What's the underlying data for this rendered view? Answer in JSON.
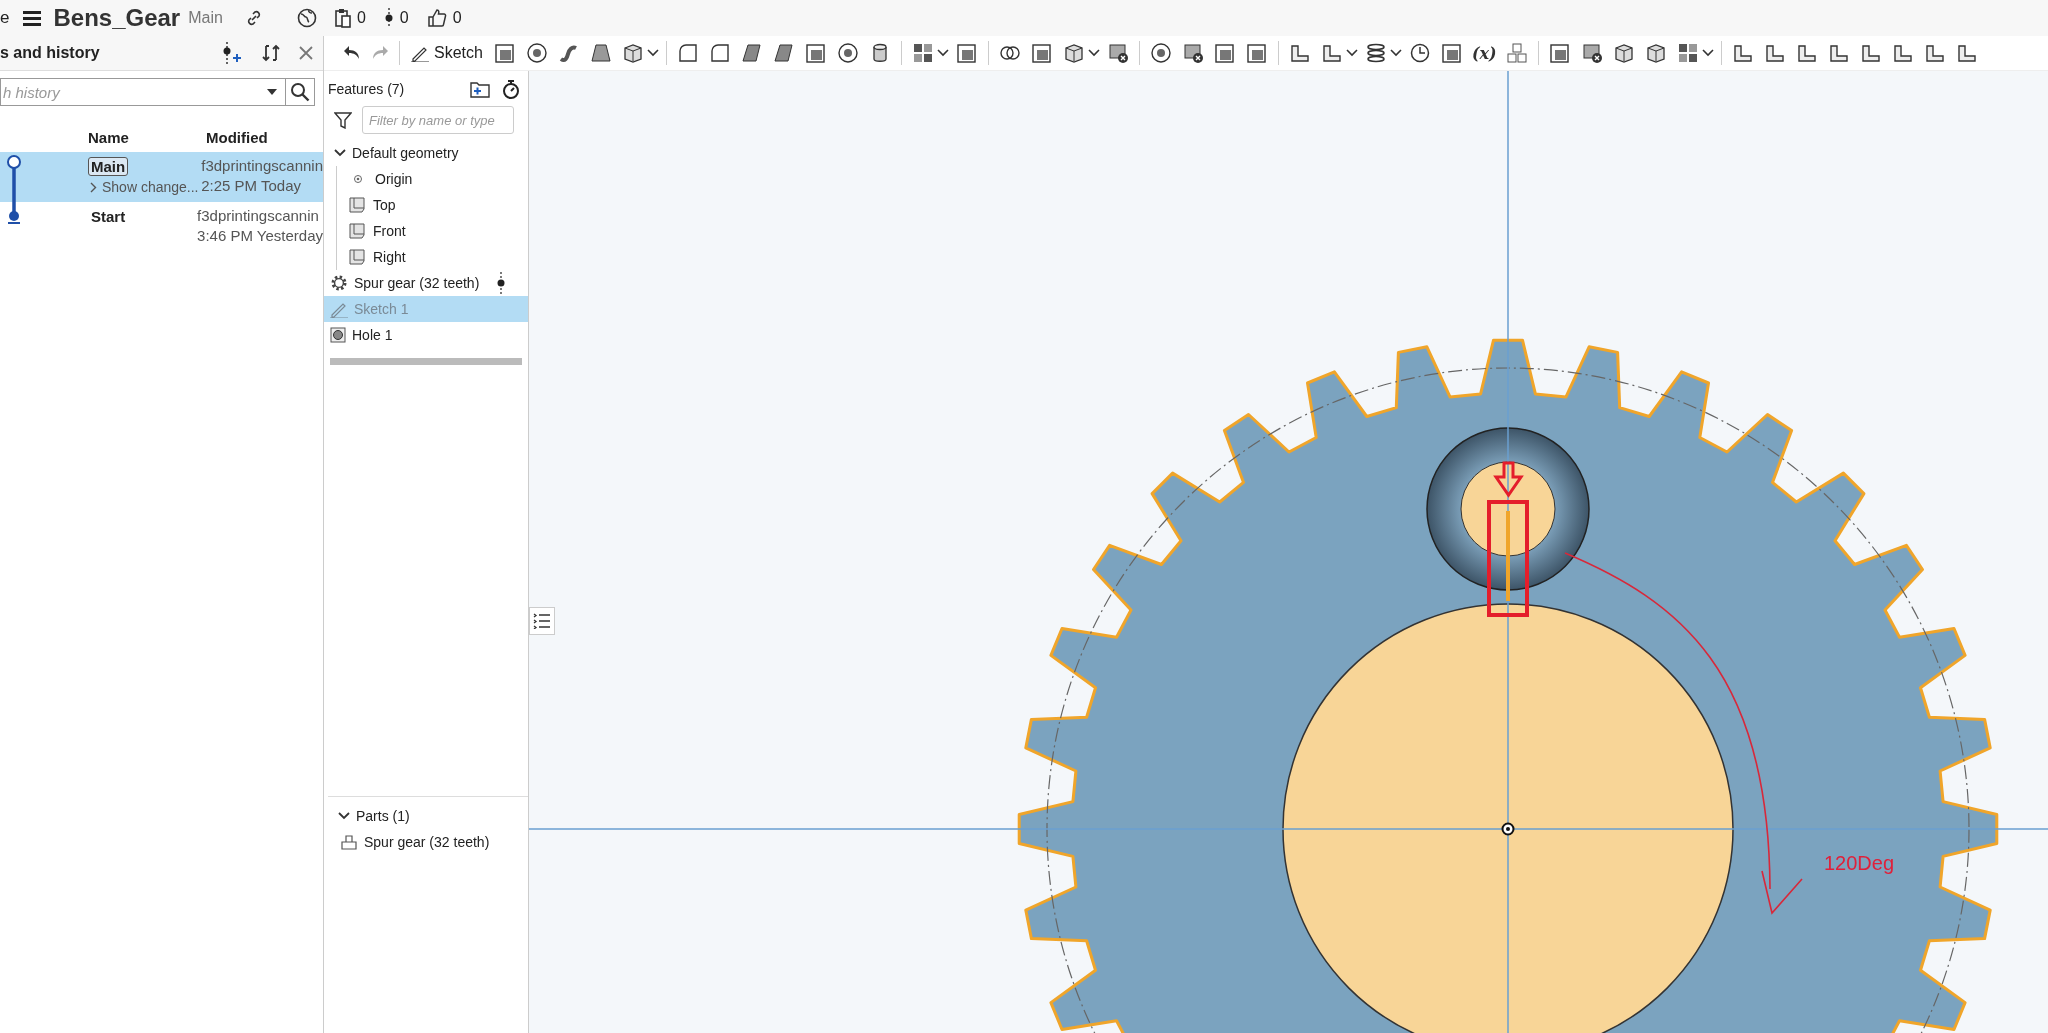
{
  "header": {
    "app_fragment": "e",
    "document_title": "Bens_Gear",
    "branch": "Main",
    "counts": [
      {
        "kind": "document",
        "value": "0"
      },
      {
        "kind": "branch",
        "value": "0"
      },
      {
        "kind": "like",
        "value": "0"
      }
    ]
  },
  "toolbar": {
    "sketch_label": "Sketch",
    "variable_label": "(x)"
  },
  "history_panel": {
    "title": "s and history",
    "search": {
      "placeholder": "h history"
    },
    "columns": [
      "Name",
      "Modified"
    ],
    "rows": [
      {
        "name": "Main",
        "current": true,
        "selected": true,
        "changes_link": "Show change...",
        "author": "f3dprintingscannin",
        "time": "2:25 PM Today"
      },
      {
        "name": "Start",
        "current": false,
        "selected": false,
        "author": "f3dprintingscannin",
        "time": "3:46 PM Yesterday"
      }
    ]
  },
  "features_panel": {
    "title": "Features (7)",
    "filter": {
      "placeholder": "Filter by name or type"
    },
    "items": [
      {
        "kind": "group",
        "label": "Default geometry",
        "expanded": true,
        "selected": false,
        "children": [
          {
            "kind": "origin",
            "label": "Origin",
            "selected": false
          },
          {
            "kind": "plane",
            "label": "Top",
            "selected": false
          },
          {
            "kind": "plane",
            "label": "Front",
            "selected": false
          },
          {
            "kind": "plane",
            "label": "Right",
            "selected": false
          }
        ]
      },
      {
        "kind": "gear",
        "label": "Spur gear (32 teeth)",
        "selected": false,
        "rollback": true
      },
      {
        "kind": "sketch",
        "label": "Sketch 1",
        "selected": true,
        "rollback": false
      },
      {
        "kind": "hole",
        "label": "Hole 1",
        "selected": false,
        "rollback": false
      }
    ]
  },
  "parts_panel": {
    "title": "Parts (1)",
    "expanded": true,
    "items": [
      {
        "label": "Spur gear (32 teeth)"
      }
    ]
  },
  "viewport": {
    "annotation": "120Deg"
  }
}
